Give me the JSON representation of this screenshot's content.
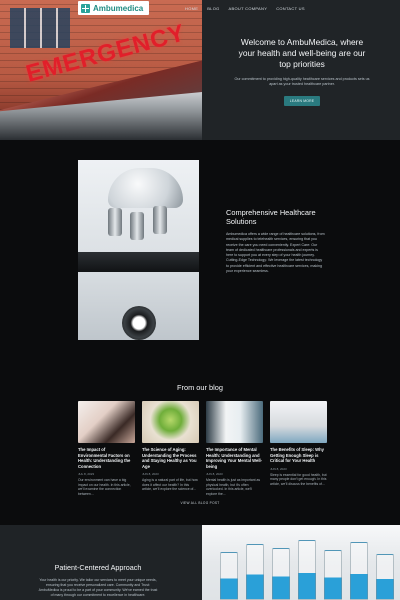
{
  "header": {
    "logo_text": "Ambumedica",
    "nav": [
      "HOME",
      "BLOG",
      "ABOUT COMPANY",
      "CONTACT US"
    ]
  },
  "hero": {
    "image_sign_text": "EMERGENCY",
    "title": "Welcome to AmbuMedica, where your health and well-being are our top priorities",
    "subtitle": "Our commitment to providing high-quality healthcare services and products sets us apart as your trusted healthcare partner.",
    "cta_label": "LEARN MORE"
  },
  "about": {
    "title": "Comprehensive Healthcare Solutions",
    "body": "Ambumedica offers a wide range of healthcare solutions, from medical supplies to telehealth services, ensuring that you receive the care you need conveniently. Expert Care: Our team of dedicated healthcare professionals and experts is here to support you at every step of your health journey. Cutting-Edge Technology: We leverage the latest technology to provide efficient and effective healthcare services, making your experience seamless."
  },
  "blog": {
    "heading": "From our blog",
    "posts": [
      {
        "title": "The Impact of Environmental Factors on Health: Understanding the Connection",
        "date": "JUL 8, 2023",
        "excerpt": "Our environment can have a big impact on our health. In this article, we'll examine the connection between..."
      },
      {
        "title": "The Science of Aging: Understanding the Process and Staying Healthy as You Age",
        "date": "JUN 8, 2023",
        "excerpt": "Aging is a natural part of life, but how does it affect our health? In this article, we'll explore the science of..."
      },
      {
        "title": "The Importance of Mental Health: Understanding and Improving Your Mental Well-being",
        "date": "JUN 8, 2023",
        "excerpt": "Mental health is just as important as physical health, but it's often overlooked. In this article, we'll explore the..."
      },
      {
        "title": "The Benefits of Sleep: Why Getting Enough Sleep is Critical for Your Health",
        "date": "JUN 8, 2023",
        "excerpt": "Sleep is essential for good health, but many people don't get enough. In this article, we'll discuss the benefits of..."
      }
    ],
    "view_all_label": "VIEW ALL BLOG POST"
  },
  "patient": {
    "title": "Patient-Centered Approach",
    "body": "Your health is our priority. We tailor our services to meet your unique needs, ensuring that you receive personalized care. Community and Trust: AmbuMedica is proud to be a part of your community. We've earned the trust of many through our commitment to excellence in healthcare."
  },
  "colors": {
    "accent": "#2a7a7f",
    "background": "#0b0c0d",
    "panel": "#1f2326"
  }
}
